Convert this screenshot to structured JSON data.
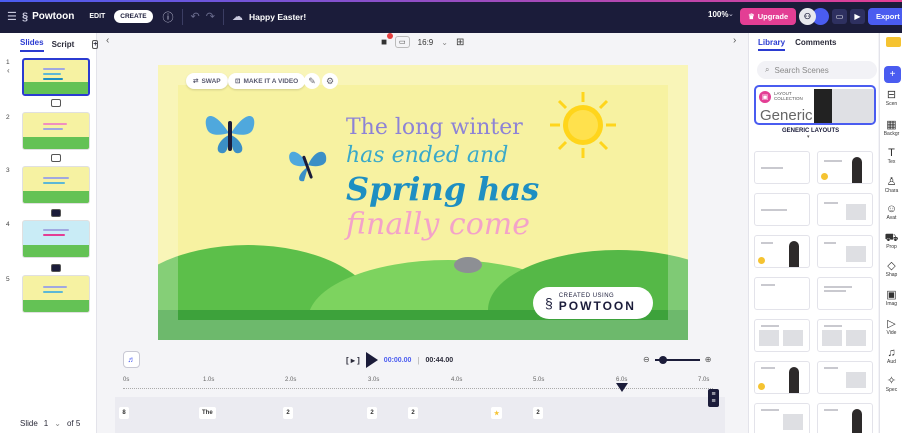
{
  "topbar": {
    "brand": "Powtoon",
    "mode_edit": "EDIT",
    "mode_create": "CREATE",
    "project_title": "Happy Easter!",
    "zoom": "100%",
    "upgrade_label": "Upgrade",
    "export_label": "Export",
    "colors": {
      "bg": "#1b1c3a",
      "upgrade": "#e33e94",
      "export": "#4a5cf0"
    }
  },
  "left_panel": {
    "tabs": [
      "Slides",
      "Script"
    ],
    "slides": [
      {
        "number": "1",
        "selected": true
      },
      {
        "number": "2",
        "selected": false
      },
      {
        "number": "3",
        "selected": false
      },
      {
        "number": "4",
        "selected": false
      },
      {
        "number": "5",
        "selected": false
      }
    ],
    "footer": {
      "label": "Slide",
      "current": "1",
      "total": "of 5"
    }
  },
  "canvas": {
    "ratio": "16:9",
    "actions": {
      "swap": "SWAP",
      "make_video": "MAKE IT A VIDEO"
    },
    "headline": [
      "The long winter",
      "has ended and",
      "Spring has",
      "finally come"
    ],
    "badge": {
      "small": "CREATED USING",
      "big": "POWTOON"
    }
  },
  "timeline": {
    "current_time": "00:00.00",
    "total_time": "00:44.00",
    "ticks": [
      "0s",
      "1.0s",
      "2.0s",
      "3.0s",
      "4.0s",
      "5.0s",
      "6.0s",
      "7.0s"
    ],
    "chips": [
      "8",
      "The",
      "2",
      "2",
      "2",
      "2"
    ]
  },
  "right_panel": {
    "tabs": [
      "Library",
      "Comments"
    ],
    "search_placeholder": "Search Scenes",
    "collection": {
      "kicker": "LAYOUT COLLECTION",
      "name": "Generic"
    },
    "section_title": "GENERIC LAYOUTS"
  },
  "tool_rail": [
    {
      "label": "Scen",
      "icon": "layout-icon"
    },
    {
      "label": "Backgr",
      "icon": "background-icon"
    },
    {
      "label": "Tex",
      "icon": "text-icon"
    },
    {
      "label": "Chara",
      "icon": "character-icon"
    },
    {
      "label": "Avat",
      "icon": "avatar-icon"
    },
    {
      "label": "Prop",
      "icon": "props-icon"
    },
    {
      "label": "Shap",
      "icon": "shapes-icon"
    },
    {
      "label": "Imag",
      "icon": "image-icon"
    },
    {
      "label": "Vide",
      "icon": "video-icon"
    },
    {
      "label": "Aud",
      "icon": "audio-icon"
    },
    {
      "label": "Spec",
      "icon": "special-icon"
    }
  ]
}
